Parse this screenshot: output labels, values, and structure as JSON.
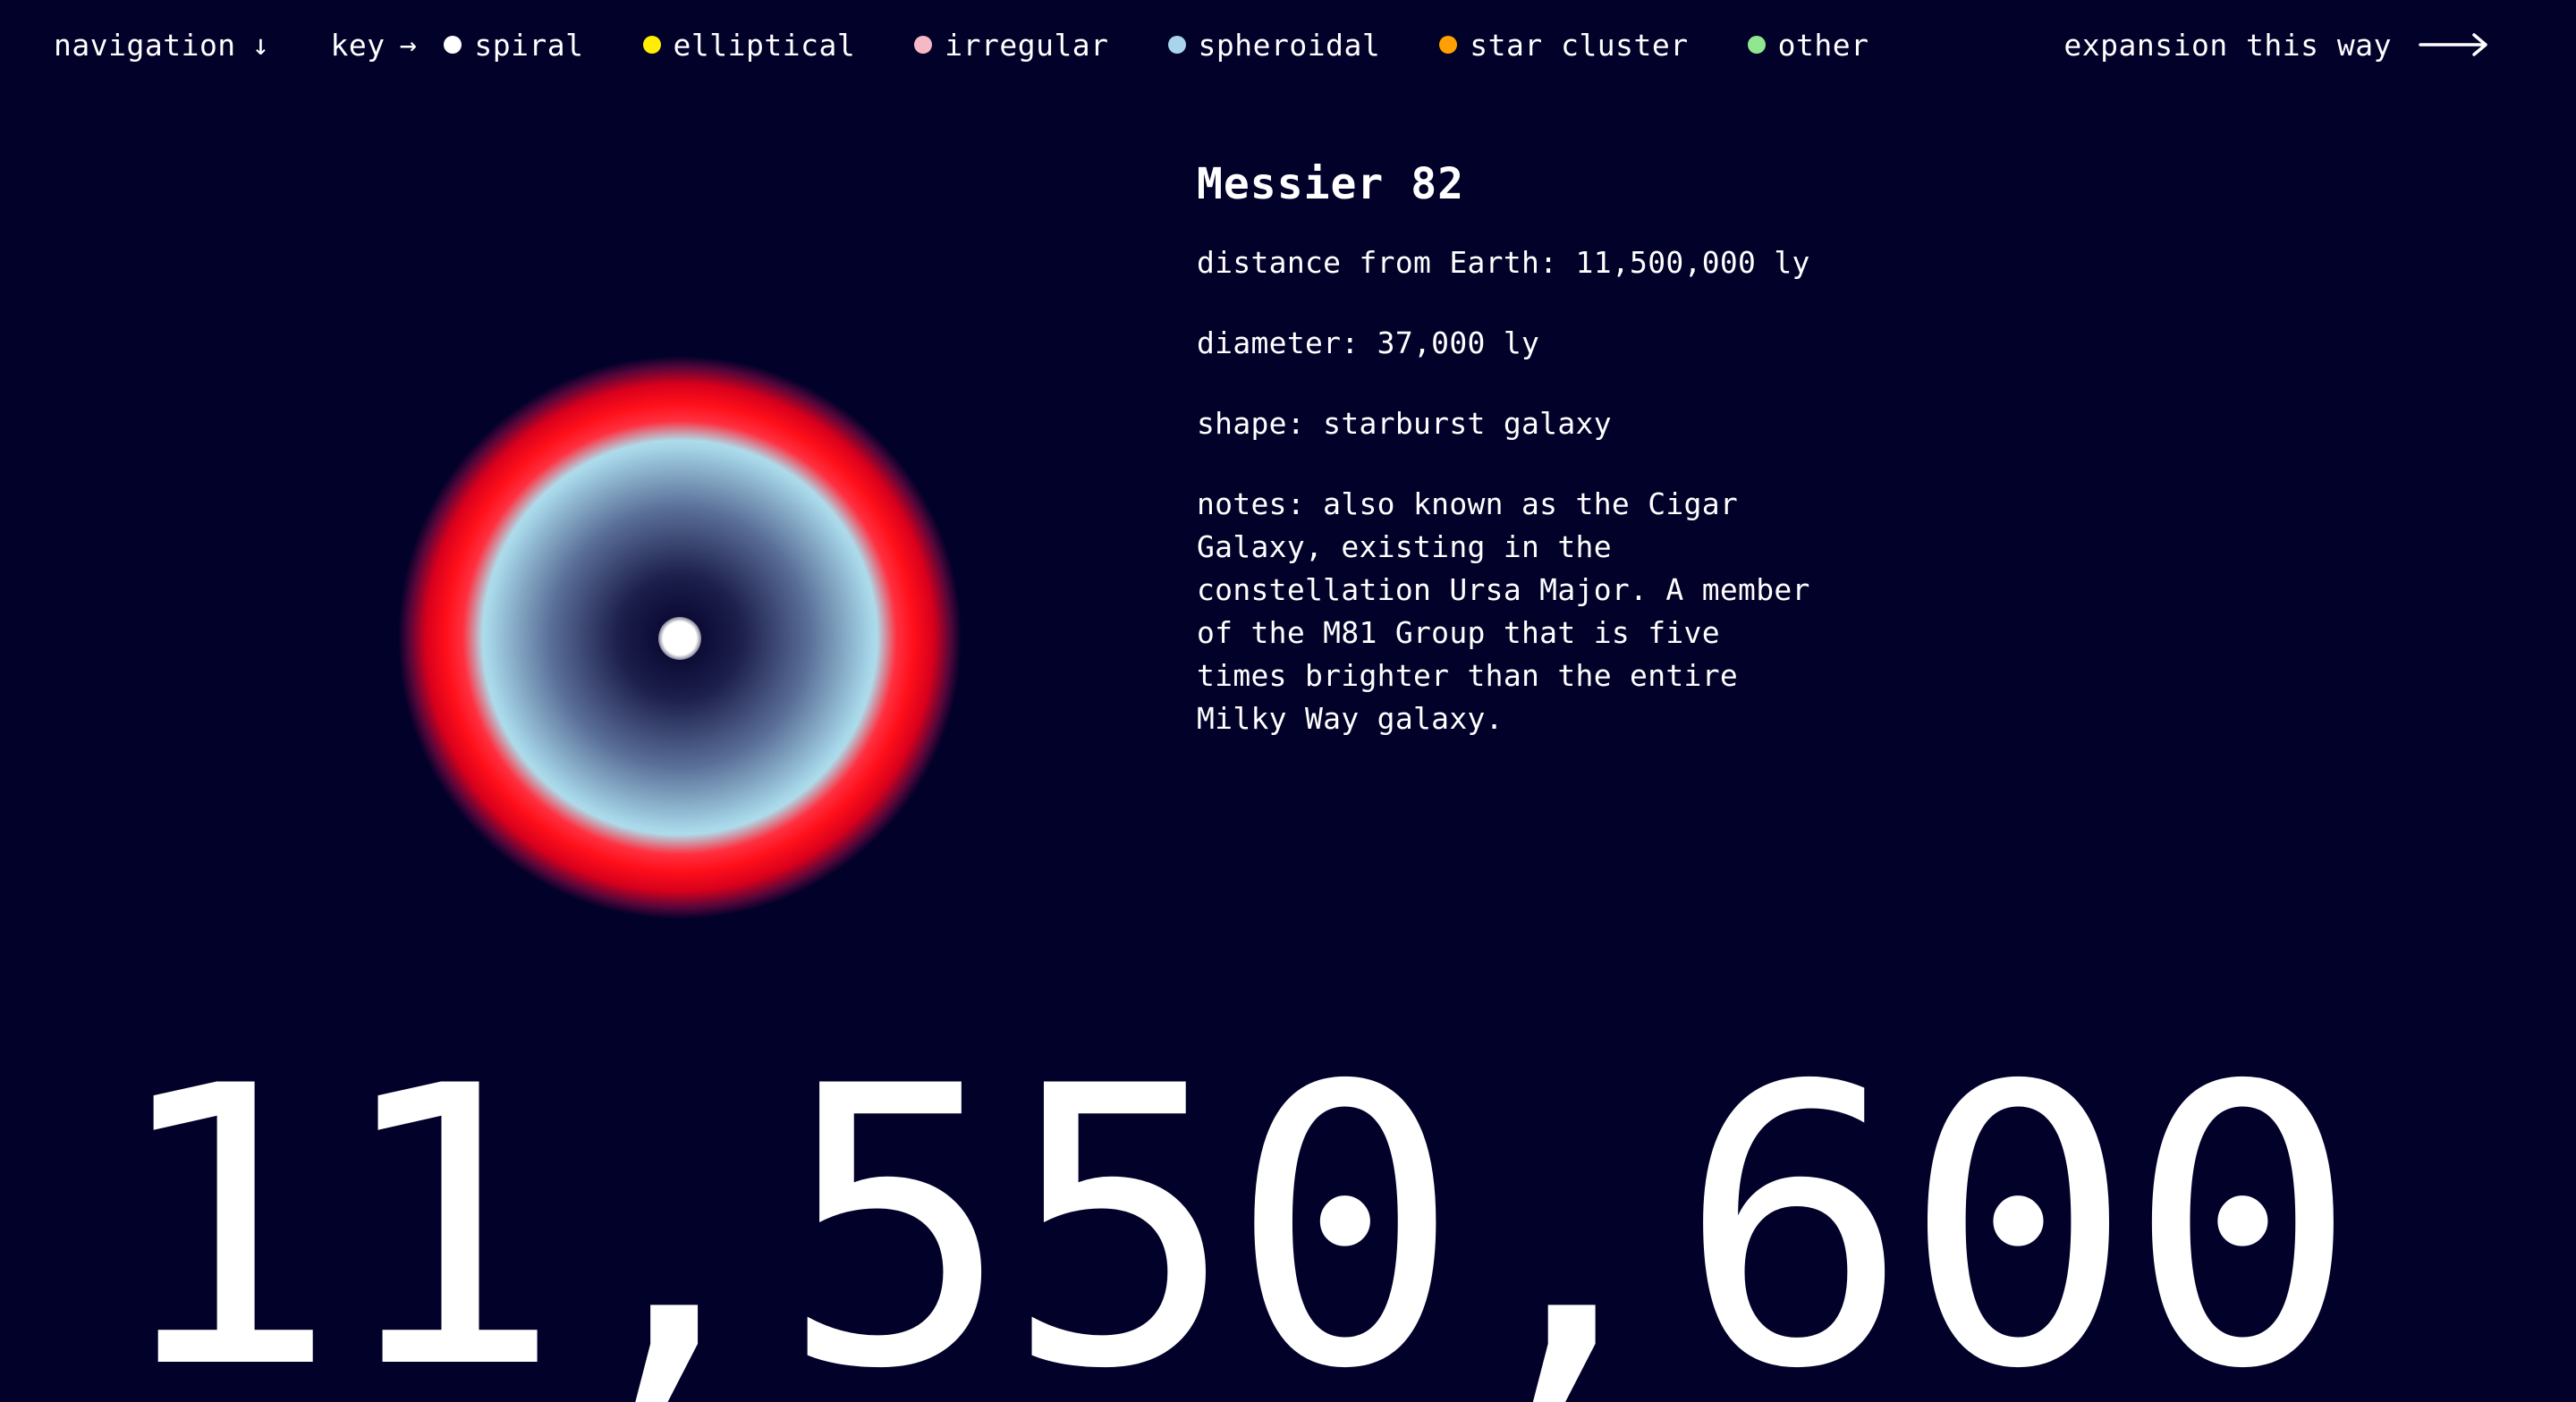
{
  "nav": {
    "navigation_label": "navigation",
    "navigation_arrow": "↓",
    "key_label": "key",
    "key_arrow": "→",
    "expansion_label": "expansion this way"
  },
  "legend": [
    {
      "label": "spiral",
      "color": "#ffffff"
    },
    {
      "label": "elliptical",
      "color": "#ffee00"
    },
    {
      "label": "irregular",
      "color": "#f7b8c6"
    },
    {
      "label": "spheroidal",
      "color": "#a8d4ec"
    },
    {
      "label": "star cluster",
      "color": "#ff9f00"
    },
    {
      "label": "other",
      "color": "#8fe88f"
    }
  ],
  "object": {
    "name": "Messier 82",
    "distance": "distance from Earth: 11,500,000 ly",
    "diameter": "diameter: 37,000 ly",
    "shape": "shape: starburst galaxy",
    "notes": "notes: also known as the Cigar Galaxy, existing in the constellation Ursa Major. A member of the M81 Group that is five times brighter than the entire Milky Way galaxy."
  },
  "counter": "11,550,600",
  "colors": {
    "background": "#02012a",
    "text": "#ffffff",
    "galaxy_outer": "#ff0f1a",
    "galaxy_inner": "#aedbea"
  }
}
